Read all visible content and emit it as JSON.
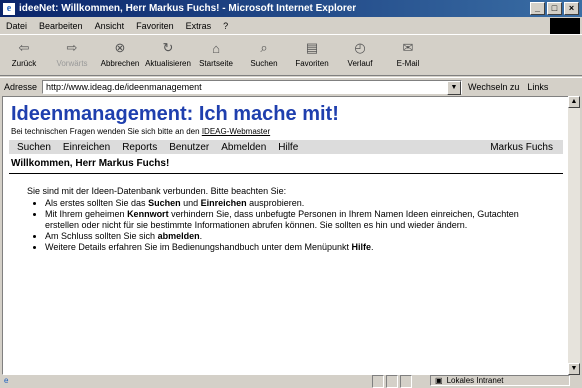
{
  "window": {
    "title": "ideeNet: Willkommen, Herr Markus Fuchs! - Microsoft Internet Explorer",
    "minimize": "_",
    "maximize": "□",
    "close": "×"
  },
  "menu": [
    "Datei",
    "Bearbeiten",
    "Ansicht",
    "Favoriten",
    "Extras",
    "?"
  ],
  "toolbar": [
    {
      "label": "Zurück",
      "icon": "back-arrow-icon",
      "glyph": "⇦"
    },
    {
      "label": "Vorwärts",
      "icon": "forward-arrow-icon",
      "glyph": "⇨"
    },
    {
      "label": "Abbrechen",
      "icon": "stop-icon",
      "glyph": "⊗"
    },
    {
      "label": "Aktualisieren",
      "icon": "refresh-icon",
      "glyph": "↻"
    },
    {
      "label": "Startseite",
      "icon": "home-icon",
      "glyph": "⌂"
    },
    {
      "label": "Suchen",
      "icon": "search-icon",
      "glyph": "⌕"
    },
    {
      "label": "Favoriten",
      "icon": "favorites-icon",
      "glyph": "▤"
    },
    {
      "label": "Verlauf",
      "icon": "history-icon",
      "glyph": "◴"
    },
    {
      "label": "E-Mail",
      "icon": "mail-icon",
      "glyph": "✉"
    }
  ],
  "address": {
    "label": "Adresse",
    "url": "http://www.ideag.de/ideenmanagement",
    "go": "Wechseln zu",
    "links": "Links"
  },
  "page": {
    "title": "Ideenmanagement: Ich mache mit!",
    "subline_prefix": "Bei technischen Fragen wenden Sie sich bitte an den",
    "webmaster_link": "IDEAG-Webmaster",
    "nav": [
      "Suchen",
      "Einreichen",
      "Reports",
      "Benutzer",
      "Abmelden",
      "Hilfe"
    ],
    "user": "Markus Fuchs",
    "welcome": "Willkommen, Herr Markus Fuchs!",
    "intro": "Sie sind mit der Ideen-Datenbank verbunden. Bitte beachten Sie:",
    "tips": [
      {
        "pre": "Als erstes sollten Sie das",
        "b1": "Suchen",
        "mid": "und",
        "b2": "Einreichen",
        "post": "ausprobieren."
      },
      {
        "pre": "Mit Ihrem geheimen",
        "b1": "Kennwort",
        "post": "verhindern Sie, dass unbefugte Personen in Ihrem Namen Ideen einreichen, Gutachten erstellen oder nicht für sie bestimmte Informationen abrufen können. Sie sollten es hin und wieder ändern."
      },
      {
        "pre": "Am Schluss sollten Sie sich",
        "b1": "abmelden",
        "post": "."
      },
      {
        "pre": "Weitere Details erfahren Sie im Bedienungshandbuch unter dem Menüpunkt",
        "b1": "Hilfe",
        "post": "."
      }
    ]
  },
  "status": {
    "zone": "Lokales Intranet"
  }
}
